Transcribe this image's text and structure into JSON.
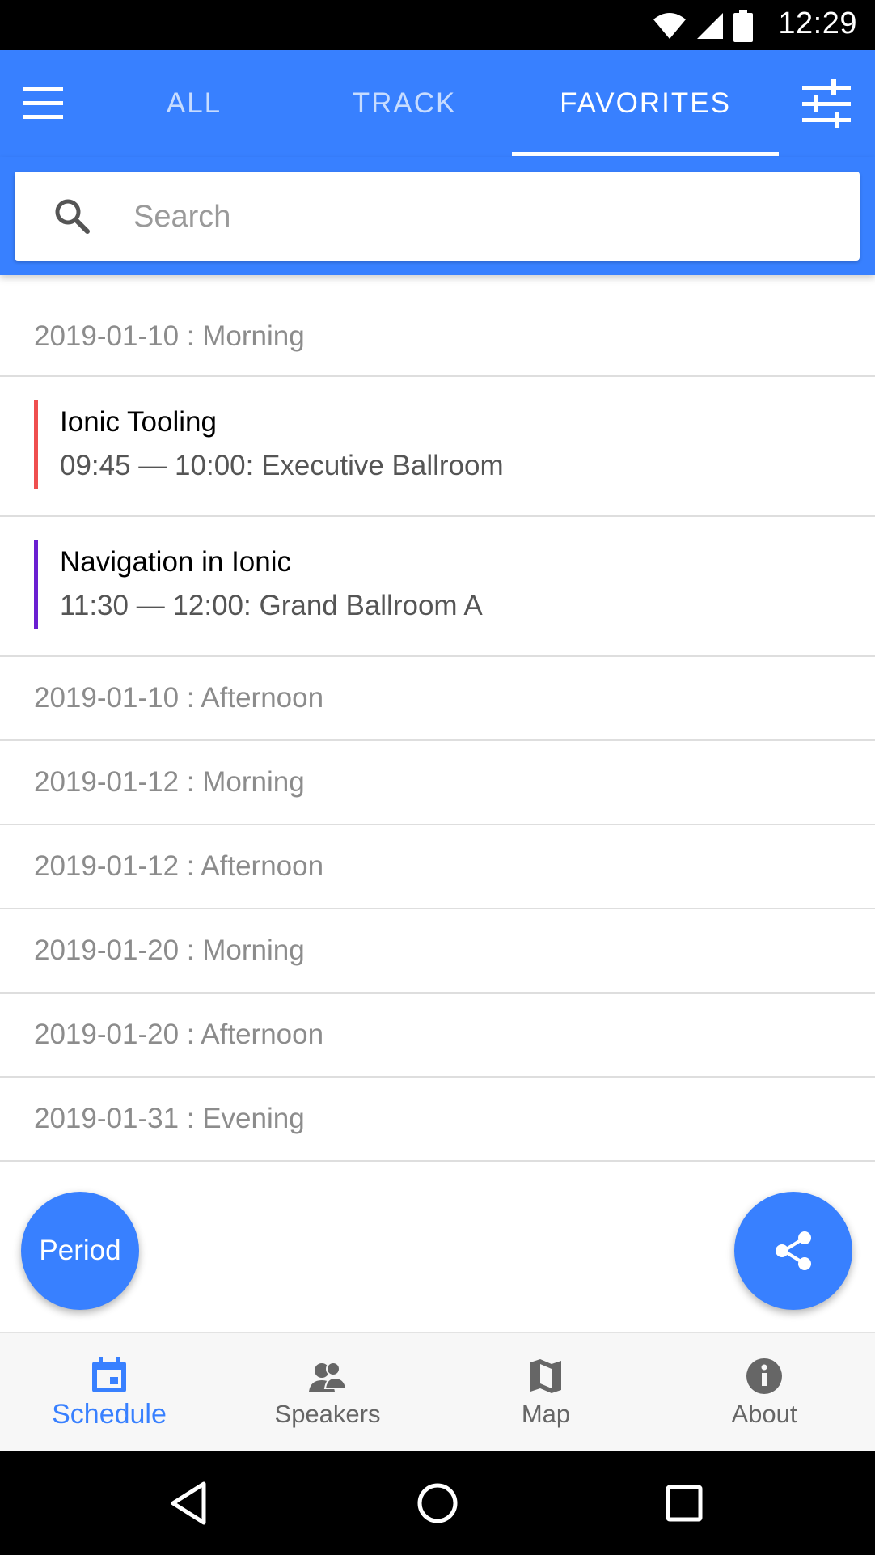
{
  "status": {
    "time": "12:29"
  },
  "toolbar": {
    "tabs": [
      {
        "label": "ALL"
      },
      {
        "label": "TRACK"
      },
      {
        "label": "FAVORITES"
      }
    ]
  },
  "search": {
    "placeholder": "Search"
  },
  "groups": [
    {
      "label": "2019-01-10 : Morning"
    },
    {
      "label": "2019-01-10 : Afternoon"
    },
    {
      "label": "2019-01-12 : Morning"
    },
    {
      "label": "2019-01-12 : Afternoon"
    },
    {
      "label": "2019-01-20 : Morning"
    },
    {
      "label": "2019-01-20 : Afternoon"
    },
    {
      "label": "2019-01-31 : Evening"
    }
  ],
  "sessions": [
    {
      "title": "Ionic Tooling",
      "detail": "09:45 — 10:00: Executive Ballroom",
      "color": "#ef4f4f"
    },
    {
      "title": "Navigation in Ionic",
      "detail": "11:30 — 12:00: Grand Ballroom A",
      "color": "#6a1fd1"
    }
  ],
  "fab": {
    "period_label": "Period"
  },
  "tabbar": {
    "items": [
      {
        "label": "Schedule",
        "icon": "calendar-icon"
      },
      {
        "label": "Speakers",
        "icon": "people-icon"
      },
      {
        "label": "Map",
        "icon": "map-icon"
      },
      {
        "label": "About",
        "icon": "info-icon"
      }
    ]
  },
  "colors": {
    "primary": "#3880ff",
    "statusbar": "#000000"
  }
}
